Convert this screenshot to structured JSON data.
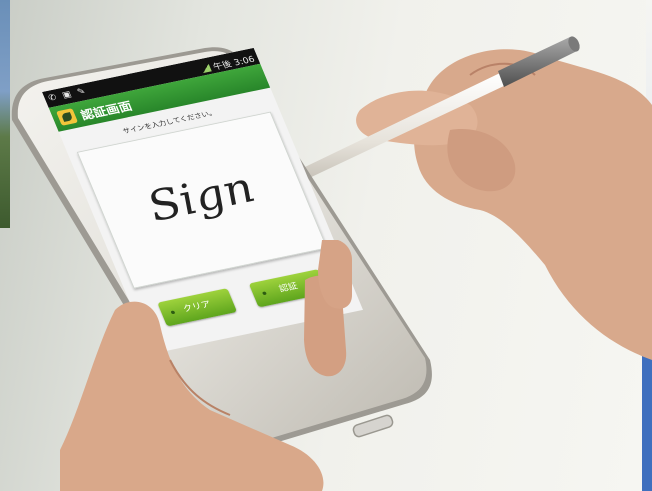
{
  "status_bar": {
    "left_icons": "✆ ▣ ✎",
    "time": "午後 3:06"
  },
  "app_bar": {
    "title": "認証画面"
  },
  "main": {
    "instruction": "サインを入力してください。",
    "signature_text": "Sign",
    "clear_button": "クリア",
    "auth_button": "認証"
  },
  "colors": {
    "app_bar_green": "#2f9a31",
    "button_green": "#7cc02c",
    "status_bar": "#111111",
    "sign_area": "#fbfbfb"
  }
}
